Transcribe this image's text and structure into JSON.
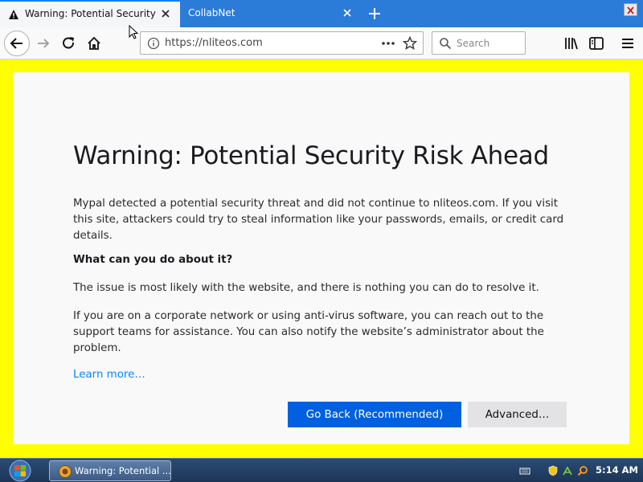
{
  "browser": {
    "tabs": [
      {
        "title": "Warning: Potential Security Risk Ahead",
        "active": true
      },
      {
        "title": "CollabNet",
        "active": false
      }
    ],
    "url": "https://nliteos.com",
    "search_placeholder": "Search"
  },
  "page": {
    "title": "Warning: Potential Security Risk Ahead",
    "intro": "Mypal detected a potential security threat and did not continue to nliteos.com. If you visit this site, attackers could try to steal information like your passwords, emails, or credit card details.",
    "heading": "What can you do about it?",
    "para1": "The issue is most likely with the website, and there is nothing you can do to resolve it.",
    "para2": "If you are on a corporate network or using anti-virus software, you can reach out to the support teams for assistance. You can also notify the website’s administrator about the problem.",
    "learn_more": "Learn more…",
    "go_back": "Go Back (Recommended)",
    "advanced": "Advanced…"
  },
  "taskbar": {
    "window_label": "Warning: Potential ...",
    "clock": "5:14 AM"
  },
  "colors": {
    "page_border": "#ffff00",
    "primary_button": "#0060df",
    "link": "#0a84ff",
    "tabstrip": "#2b7bd9"
  }
}
